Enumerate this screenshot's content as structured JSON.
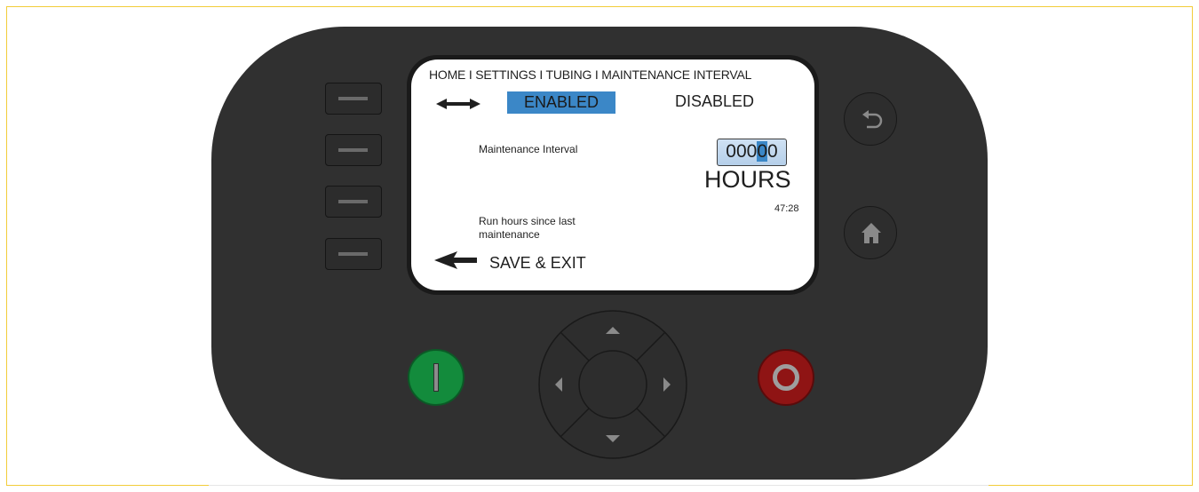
{
  "screen": {
    "breadcrumb": "HOME I SETTINGS I TUBING I MAINTENANCE INTERVAL",
    "toggle": {
      "enabled_label": "ENABLED",
      "disabled_label": "DISABLED",
      "selected": "ENABLED"
    },
    "maintenance_interval": {
      "label": "Maintenance Interval",
      "value_prefix": "000",
      "value_cursor_digit": "0",
      "value_suffix": "0",
      "unit": "HOURS"
    },
    "run_hours": {
      "label": "Run hours since last maintenance",
      "value": "47:28"
    },
    "save_exit_label": "SAVE & EXIT"
  },
  "colors": {
    "device_body": "#303030",
    "selection": "#3b87c7",
    "start": "#138b3c",
    "stop": "#8f1414",
    "frame": "#f2cd3a"
  },
  "icons": [
    "left-right-arrow-icon",
    "back-arrow-icon",
    "return-icon",
    "home-icon",
    "up-icon",
    "down-icon",
    "left-icon",
    "right-icon"
  ]
}
